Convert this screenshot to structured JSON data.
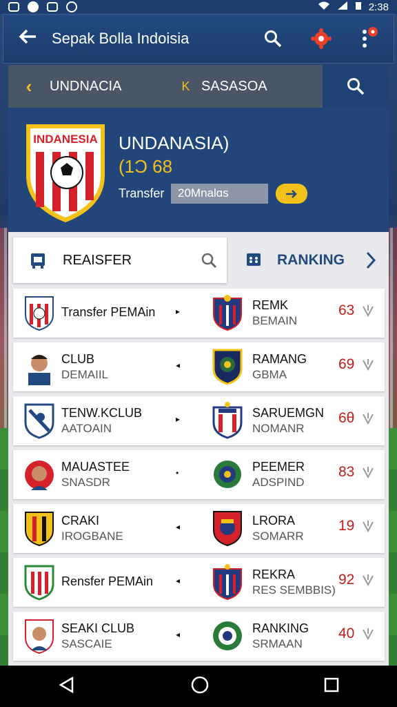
{
  "status": {
    "time": "2:38"
  },
  "app_bar": {
    "title": "Sepak Bolla Indoisia"
  },
  "sub_bar": {
    "tab_left": "UNDNACIA",
    "tab_sep": "K",
    "tab_right": "SASASOA"
  },
  "hero": {
    "crest_text": "INDANESIA",
    "team_name": "UNDANASIA)",
    "score": "(1Ɔ 68",
    "transfer_label": "Transfer",
    "transfer_value": "20Mnalɑs"
  },
  "segments": {
    "left_label": "REAISFER",
    "right_label": "RANKING"
  },
  "rows": [
    {
      "left_main": "Transfer PEMAin",
      "left_sub": "",
      "arrow": "▸",
      "right_main": "REMK",
      "right_sub": "BEMAIN",
      "score": "63"
    },
    {
      "left_main": "CLUB",
      "left_sub": "DEMAIIL",
      "arrow": "◂",
      "right_main": "RAMANG",
      "right_sub": "GBMA",
      "score": "69"
    },
    {
      "left_main": "TENW.KCLUB",
      "left_sub": "AATOAIN",
      "arrow": "▸",
      "right_main": "SARUEMGN",
      "right_sub": "NOMANR",
      "score": "6θ"
    },
    {
      "left_main": "MAUASTEE",
      "left_sub": "SNASDR",
      "arrow": "•",
      "right_main": "PEEMER",
      "right_sub": "ADSPIND",
      "score": "83"
    },
    {
      "left_main": "CRAKI",
      "left_sub": "IROGBANE",
      "arrow": "◂",
      "right_main": "LRORA",
      "right_sub": "SOMARR",
      "score": "19"
    },
    {
      "left_main": "Rensfer PEMAin",
      "left_sub": "",
      "arrow": "◂",
      "right_main": "REKRA",
      "right_sub": "RES SEMBBIS)",
      "score": "92"
    },
    {
      "left_main": "SEAKI CLUB",
      "left_sub": "SASCAIE",
      "arrow": "◂",
      "right_main": "RANKING",
      "right_sub": "SRMAAN",
      "score": "40"
    }
  ],
  "colors": {
    "primary": "#234a80",
    "accent": "#f3c21a",
    "score_red": "#c11b1b"
  }
}
